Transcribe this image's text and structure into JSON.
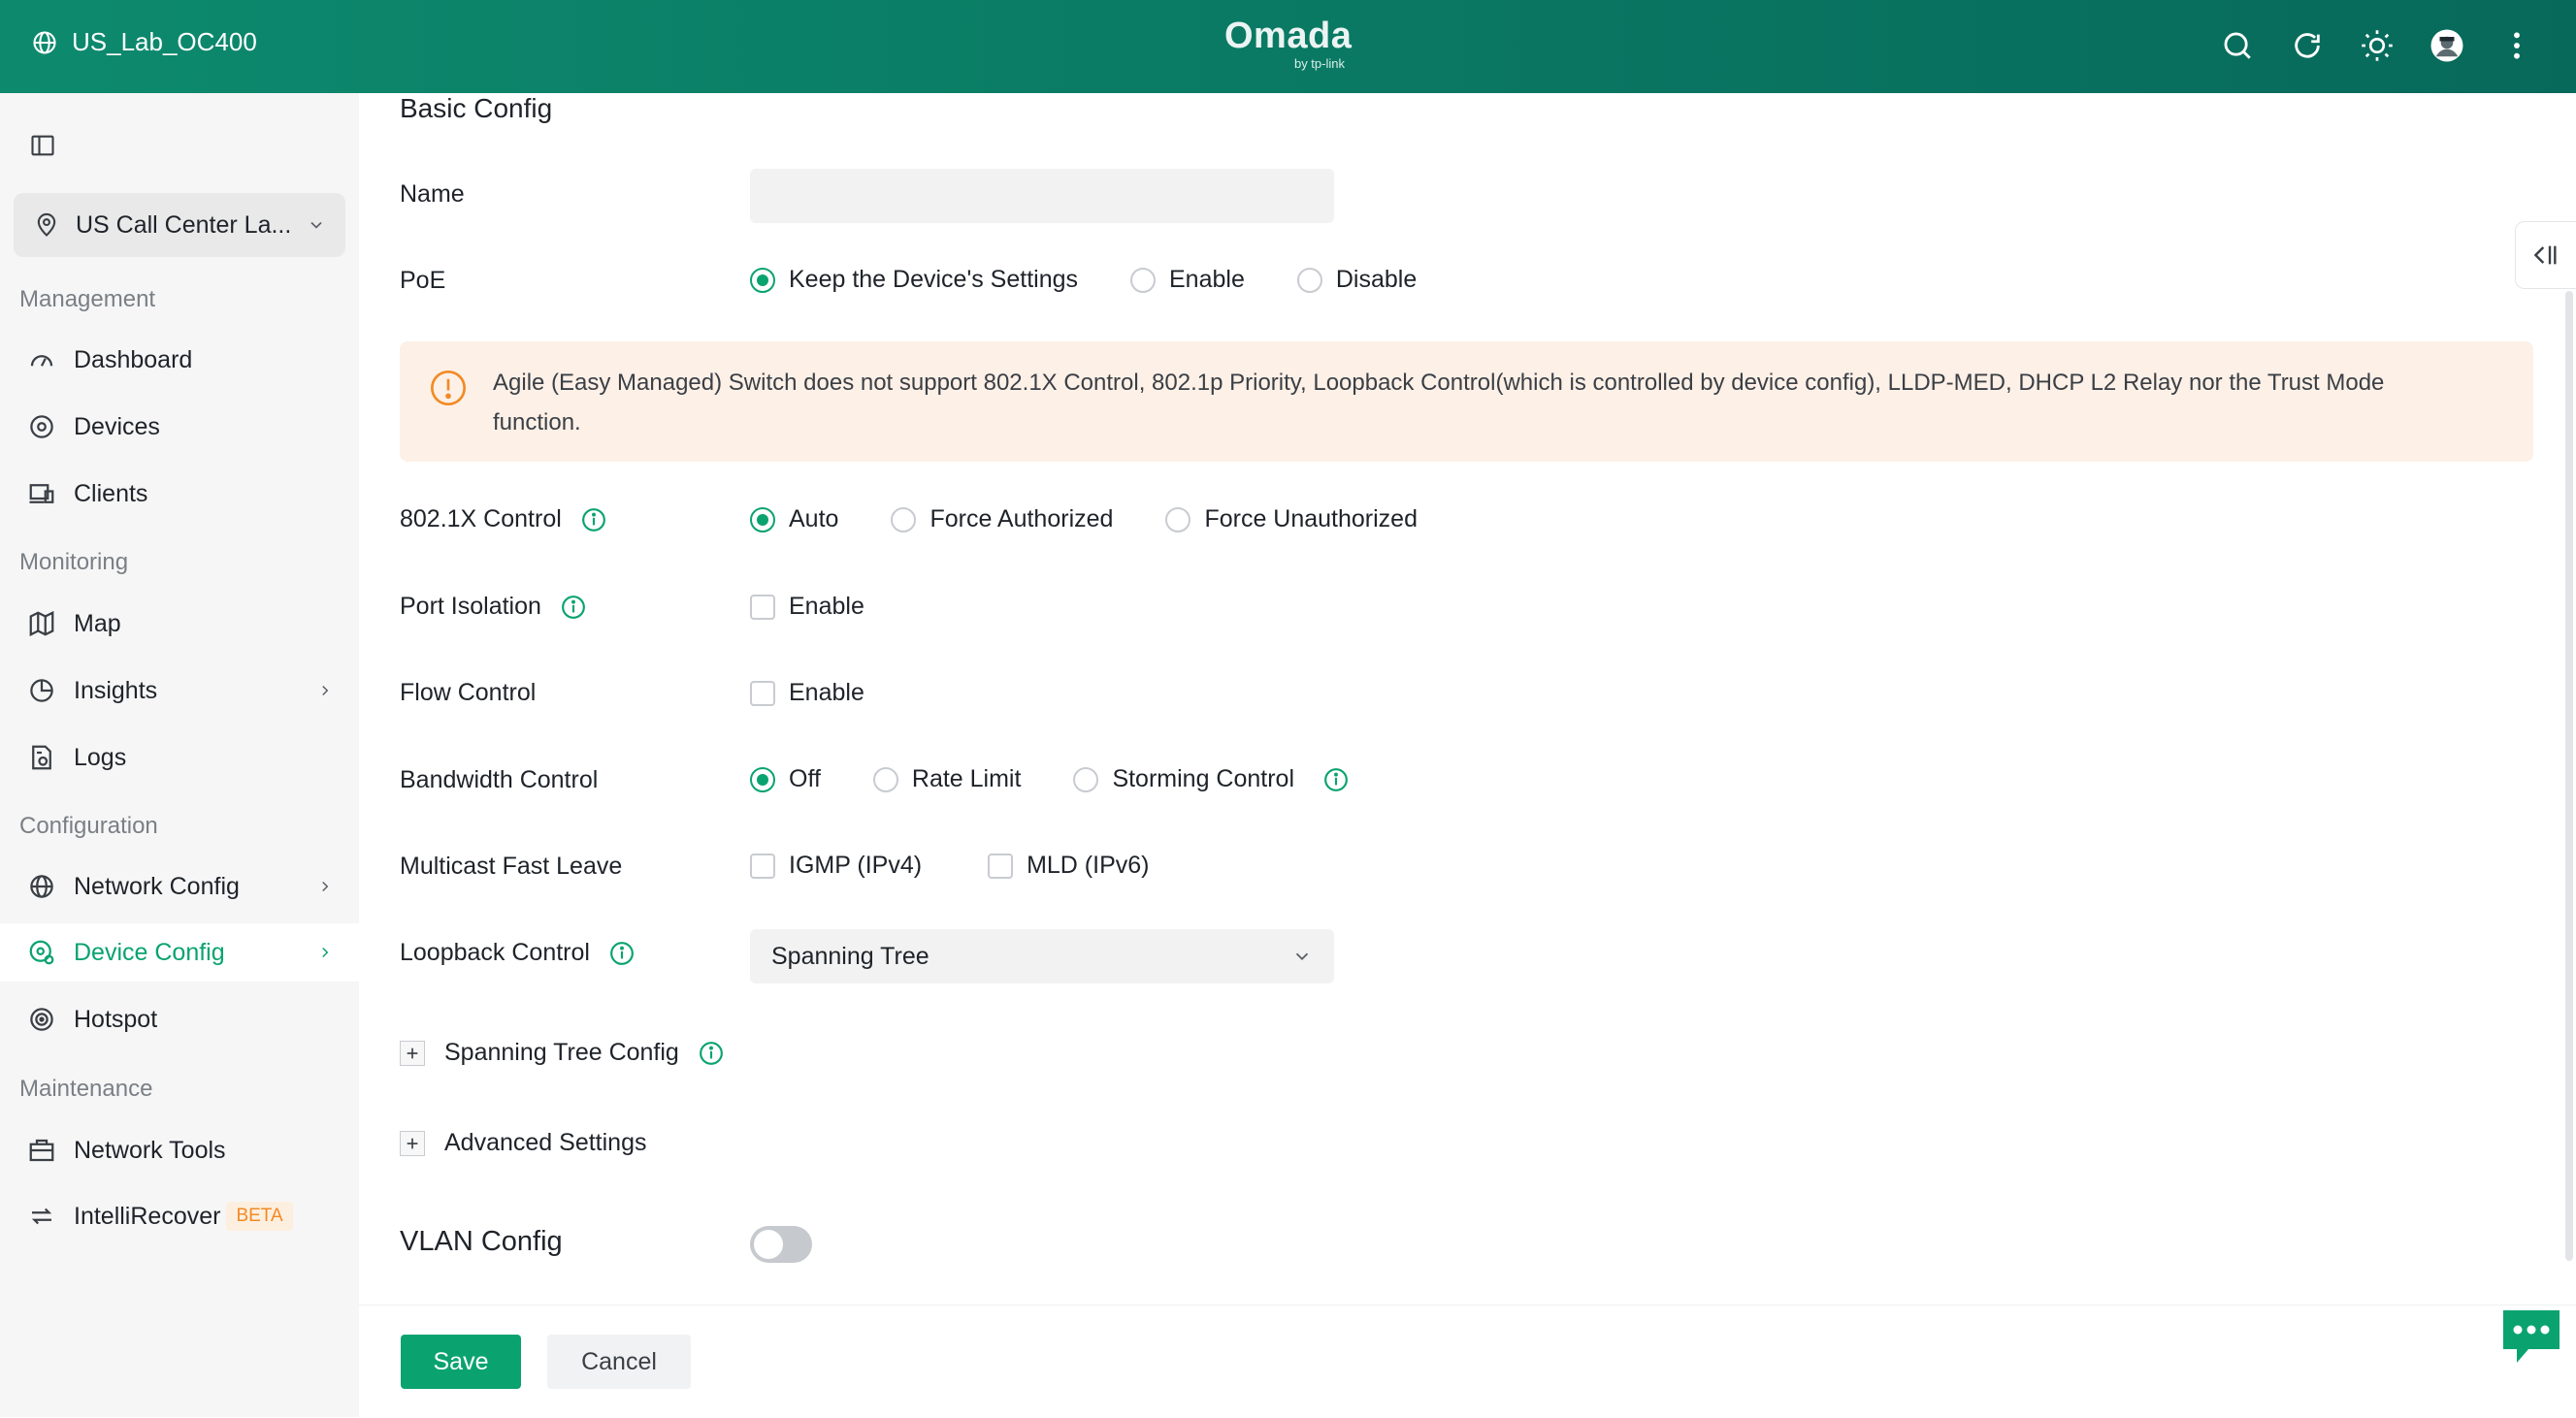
{
  "header": {
    "site_name": "US_Lab_OC400",
    "brand": "Omada",
    "brand_sub": "by tp-link",
    "icons": [
      "search-icon",
      "refresh-icon",
      "theme-sun-icon",
      "avatar",
      "more-vertical-icon"
    ]
  },
  "sidebar": {
    "site_selector": "US Call Center La...",
    "groups": {
      "management": "Management",
      "monitoring": "Monitoring",
      "configuration": "Configuration",
      "maintenance": "Maintenance"
    },
    "items": {
      "dashboard": "Dashboard",
      "devices": "Devices",
      "clients": "Clients",
      "map": "Map",
      "insights": "Insights",
      "logs": "Logs",
      "network_config": "Network Config",
      "device_config": "Device Config",
      "hotspot": "Hotspot",
      "network_tools": "Network Tools",
      "intellirecover": "IntelliRecover",
      "intellirecover_badge": "BETA"
    },
    "active_item": "Device Config"
  },
  "main": {
    "section_title": "Basic Config",
    "name": {
      "label": "Name",
      "value": ""
    },
    "poe": {
      "label": "PoE",
      "options": [
        "Keep the Device's Settings",
        "Enable",
        "Disable"
      ],
      "selected": "Keep the Device's Settings"
    },
    "alert": "Agile (Easy Managed) Switch does not support 802.1X Control, 802.1p Priority, Loopback Control(which is controlled by device config), LLDP-MED, DHCP L2 Relay nor the Trust Mode function.",
    "dot1x": {
      "label": "802.1X Control",
      "options": [
        "Auto",
        "Force Authorized",
        "Force Unauthorized"
      ],
      "selected": "Auto"
    },
    "port_isolation": {
      "label": "Port Isolation",
      "option": "Enable",
      "checked": false
    },
    "flow_control": {
      "label": "Flow Control",
      "option": "Enable",
      "checked": false
    },
    "bandwidth": {
      "label": "Bandwidth Control",
      "options": [
        "Off",
        "Rate Limit",
        "Storming Control"
      ],
      "selected": "Off"
    },
    "multicast": {
      "label": "Multicast Fast Leave",
      "options": [
        "IGMP (IPv4)",
        "MLD (IPv6)"
      ],
      "checked": [
        false,
        false
      ]
    },
    "loopback": {
      "label": "Loopback Control",
      "value": "Spanning Tree"
    },
    "spanning_tree_config": "Spanning Tree Config",
    "advanced_settings": "Advanced Settings",
    "vlan": {
      "label": "VLAN Config",
      "enabled": false
    }
  },
  "footer": {
    "save": "Save",
    "cancel": "Cancel"
  },
  "colors": {
    "accent": "#0aa36f",
    "header": "#07695a",
    "warning": "#f28a23",
    "alert_bg": "#fdf0e7"
  }
}
